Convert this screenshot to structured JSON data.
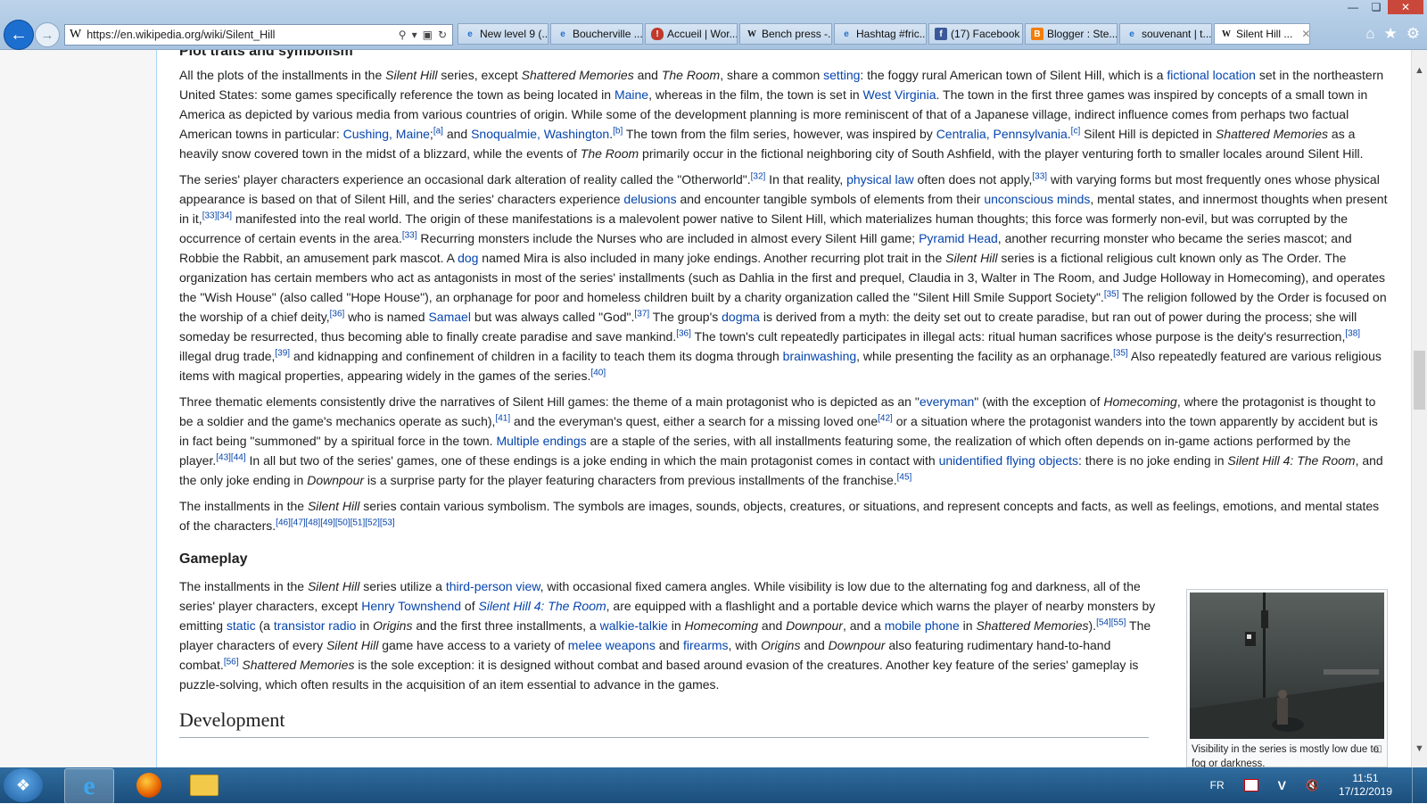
{
  "browser": {
    "url": "https://en.wikipedia.org/wiki/Silent_Hill",
    "address_logo": "W",
    "tabs": [
      {
        "label": "New level 9 (...",
        "icon": "ie-icon"
      },
      {
        "label": "Boucherville ...",
        "icon": "ie-icon"
      },
      {
        "label": "Accueil | Wor...",
        "icon": "shield-icon"
      },
      {
        "label": "Bench press -...",
        "icon": "wikipedia-icon"
      },
      {
        "label": "Hashtag #fric...",
        "icon": "ie-icon"
      },
      {
        "label": "(17) Facebook",
        "icon": "facebook-icon"
      },
      {
        "label": "Blogger : Ste...",
        "icon": "blogger-icon"
      },
      {
        "label": "souvenant | t...",
        "icon": "ie-icon"
      },
      {
        "label": "Silent Hill ...",
        "icon": "wikipedia-icon",
        "active": true
      }
    ]
  },
  "article": {
    "section_plot": "Plot traits and symbolism",
    "section_gameplay": "Gameplay",
    "section_development": "Development",
    "thumb_caption": "Visibility in the series is mostly low due to fog or darkness."
  },
  "taskbar": {
    "lang": "FR",
    "time": "11:51",
    "date": "17/12/2019"
  },
  "colors": {
    "link": "#0645ad",
    "taskbar": "#1b4e7c",
    "close_button": "#c9483b"
  }
}
